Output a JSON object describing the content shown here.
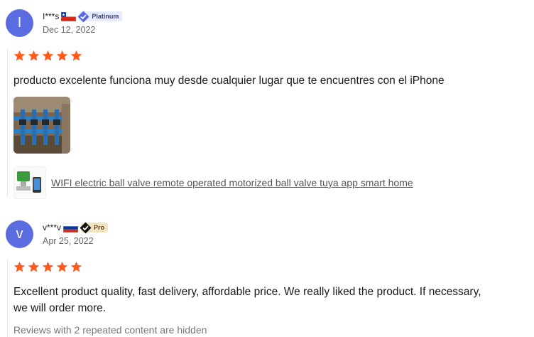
{
  "reviews": [
    {
      "avatar_letter": "I",
      "avatar_color": "#5b6be0",
      "username": "I***s",
      "country": "Chile",
      "badge": "Platinum",
      "date": "Dec 12, 2022",
      "rating": 5,
      "text": "producto excelente funciona muy desde cualquier lugar que te encuentres con el iPhone",
      "product_link": "WIFI electric ball valve remote operated motorized ball valve tuya app smart home"
    },
    {
      "avatar_letter": "v",
      "avatar_color": "#5b6be0",
      "username": "v***v",
      "country": "Russia",
      "badge": "Pro",
      "date": "Apr 25, 2022",
      "rating": 5,
      "text_line1": "Excellent product quality, fast delivery, affordable price. We really liked the product. If necessary,",
      "text_line2": "we will order more.",
      "hidden_note": "Reviews with 2 repeated content are hidden"
    }
  ],
  "colors": {
    "star": "#fd5a1e",
    "badge_platinum_bg": "#e5ecff",
    "badge_pro_bg": "#f4e4c2"
  }
}
